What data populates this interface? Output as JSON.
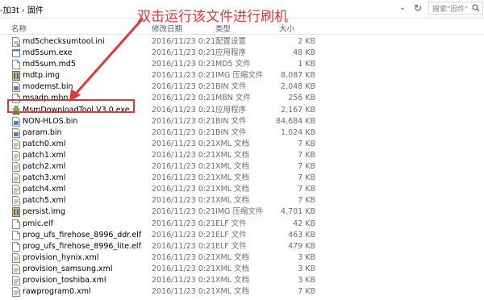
{
  "address_bar": {
    "path_part1": "-加3t",
    "path_part2": "固件",
    "search_placeholder": "搜索\"固件\""
  },
  "columns": {
    "name": "名称",
    "date": "修改日期",
    "type": "类型",
    "size": "大小"
  },
  "annotation": {
    "text": "双击运行该文件进行刷机",
    "color": "#e0383a"
  },
  "files": [
    {
      "name": "md5checksumtool.ini",
      "date": "2016/11/23 0:21",
      "type": "配置设置",
      "size": "2 KB",
      "icon": "ini-file-icon"
    },
    {
      "name": "md5sum.exe",
      "date": "2016/11/23 0:21",
      "type": "应用程序",
      "size": "48 KB",
      "icon": "exe-file-icon"
    },
    {
      "name": "md5sum.md5",
      "date": "2016/11/23 0:21",
      "type": "MD5 文件",
      "size": "1 KB",
      "icon": "generic-file-icon"
    },
    {
      "name": "mdtp.img",
      "date": "2016/11/23 0:21",
      "type": "IMG 压缩文件",
      "size": "8,087 KB",
      "icon": "img-archive-icon"
    },
    {
      "name": "modemst.bin",
      "date": "2016/11/23 0:21",
      "type": "BIN 文件",
      "size": "2,048 KB",
      "icon": "bin-file-icon"
    },
    {
      "name": "msadp.mbn",
      "date": "2016/11/23 0:21",
      "type": "MBN 文件",
      "size": "256 KB",
      "icon": "generic-file-icon"
    },
    {
      "name": "MsmDownloadTool V3.0.exe",
      "date": "2016/11/23 0:21",
      "type": "应用程序",
      "size": "2,167 KB",
      "icon": "download-tool-icon"
    },
    {
      "name": "NON-HLOS.bin",
      "date": "2016/11/23 0:21",
      "type": "BIN 文件",
      "size": "84,684 KB",
      "icon": "bin-file-icon"
    },
    {
      "name": "param.bin",
      "date": "2016/11/23 0:21",
      "type": "BIN 文件",
      "size": "1,024 KB",
      "icon": "bin-file-icon"
    },
    {
      "name": "patch0.xml",
      "date": "2016/11/23 0:21",
      "type": "XML 文档",
      "size": "7 KB",
      "icon": "xml-file-icon"
    },
    {
      "name": "patch1.xml",
      "date": "2016/11/23 0:21",
      "type": "XML 文档",
      "size": "7 KB",
      "icon": "xml-file-icon"
    },
    {
      "name": "patch2.xml",
      "date": "2016/11/23 0:21",
      "type": "XML 文档",
      "size": "7 KB",
      "icon": "xml-file-icon"
    },
    {
      "name": "patch3.xml",
      "date": "2016/11/23 0:21",
      "type": "XML 文档",
      "size": "7 KB",
      "icon": "xml-file-icon"
    },
    {
      "name": "patch4.xml",
      "date": "2016/11/23 0:21",
      "type": "XML 文档",
      "size": "7 KB",
      "icon": "xml-file-icon"
    },
    {
      "name": "patch5.xml",
      "date": "2016/11/23 0:21",
      "type": "XML 文档",
      "size": "7 KB",
      "icon": "xml-file-icon"
    },
    {
      "name": "persist.img",
      "date": "2016/11/23 0:21",
      "type": "IMG 压缩文件",
      "size": "4,701 KB",
      "icon": "img-archive-icon"
    },
    {
      "name": "pmic.elf",
      "date": "2016/11/23 0:21",
      "type": "ELF 文件",
      "size": "42 KB",
      "icon": "generic-file-icon"
    },
    {
      "name": "prog_ufs_firehose_8996_ddr.elf",
      "date": "2016/11/23 0:21",
      "type": "ELF 文件",
      "size": "463 KB",
      "icon": "generic-file-icon"
    },
    {
      "name": "prog_ufs_firehose_8996_lite.elf",
      "date": "2016/11/23 0:21",
      "type": "ELF 文件",
      "size": "479 KB",
      "icon": "generic-file-icon"
    },
    {
      "name": "provision_hynix.xml",
      "date": "2016/11/23 0:21",
      "type": "XML 文档",
      "size": "3 KB",
      "icon": "xml-file-icon"
    },
    {
      "name": "provision_samsung.xml",
      "date": "2016/11/23 0:21",
      "type": "XML 文档",
      "size": "3 KB",
      "icon": "xml-file-icon"
    },
    {
      "name": "provision_toshiba.xml",
      "date": "2016/11/23 0:21",
      "type": "XML 文档",
      "size": "3 KB",
      "icon": "xml-file-icon"
    },
    {
      "name": "rawprogram0.xml",
      "date": "2016/11/23 0:21",
      "type": "XML 文档",
      "size": "7 KB",
      "icon": "xml-file-icon"
    }
  ]
}
